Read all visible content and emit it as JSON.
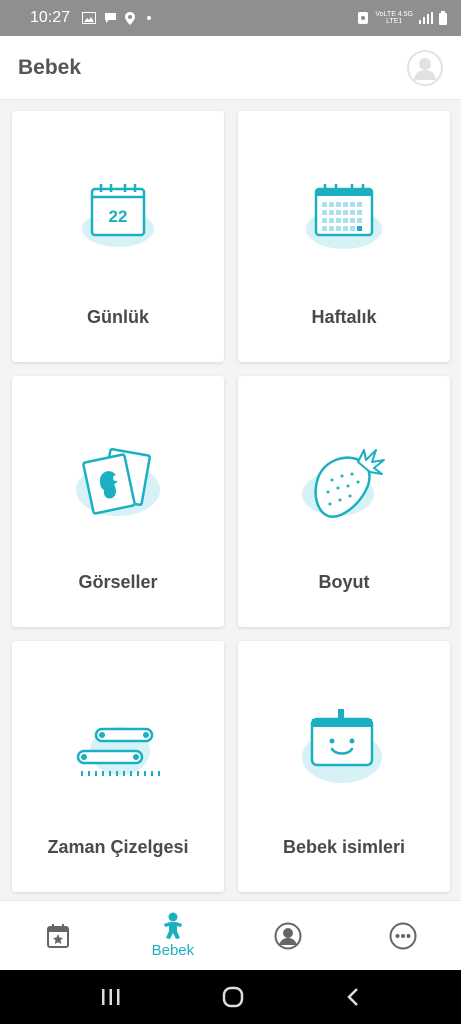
{
  "status_bar": {
    "time": "10:27",
    "network_top": "VoLTE 4.5G",
    "network_bottom": "LTE1"
  },
  "header": {
    "title": "Bebek"
  },
  "cards": [
    {
      "label": "Günlük",
      "icon": "daily-calendar-icon",
      "calendar_day": "22"
    },
    {
      "label": "Haftalık",
      "icon": "weekly-calendar-icon"
    },
    {
      "label": "Görseller",
      "icon": "photos-icon"
    },
    {
      "label": "Boyut",
      "icon": "strawberry-icon"
    },
    {
      "label": "Zaman Çizelgesi",
      "icon": "timeline-icon"
    },
    {
      "label": "Bebek isimleri",
      "icon": "baby-names-icon"
    }
  ],
  "bottom_nav": {
    "items": [
      {
        "icon": "calendar-star-icon",
        "label": ""
      },
      {
        "icon": "baby-icon",
        "label": "Bebek",
        "active": true
      },
      {
        "icon": "profile-icon",
        "label": ""
      },
      {
        "icon": "more-icon",
        "label": ""
      }
    ]
  },
  "colors": {
    "accent": "#1bb0c1",
    "accent_light": "#d7f2f6",
    "status_bar": "#8f8f8f",
    "card_bg": "#ffffff",
    "page_bg": "#f4f4f4"
  }
}
